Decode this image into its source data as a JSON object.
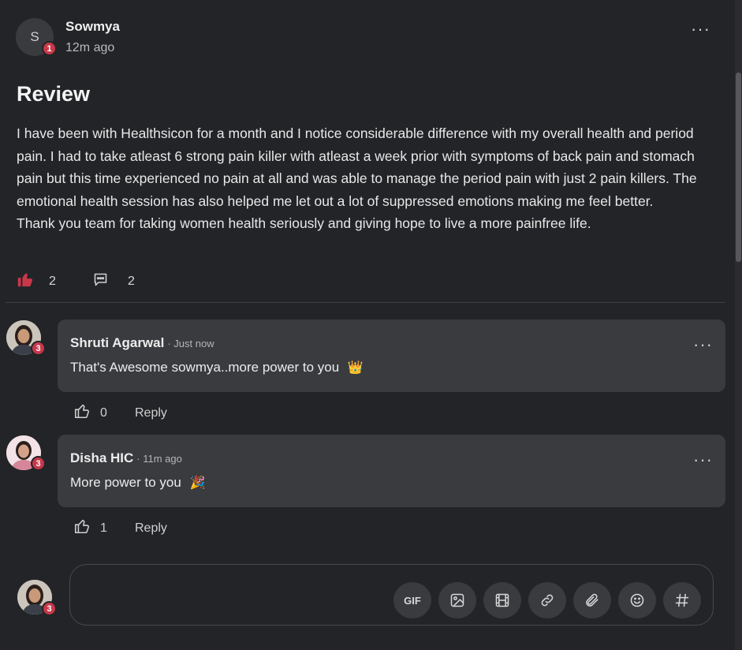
{
  "post": {
    "author_initial": "S",
    "author": "Sowmya",
    "author_badge": "1",
    "time": "12m ago",
    "title": "Review",
    "paragraph1": "I have been with Healthsicon for a month and I notice considerable difference with my overall health and period pain. I had to take atleast 6 strong pain killer with atleast a week prior with symptoms of back pain and stomach pain but this time experienced no pain at all and was able to manage the period pain with just 2 pain killers. The emotional health session has also helped me let out a lot of suppressed emotions making me feel better.",
    "paragraph2": "Thank you team for taking women health seriously and giving hope to live a more painfree life.",
    "likes": "2",
    "comments": "2"
  },
  "comments": [
    {
      "author": "Shruti Agarwal",
      "time": "· Just now",
      "text": "That's Awesome sowmya..more power to you",
      "emoji": "👑",
      "badge": "3",
      "likes": "0",
      "reply_label": "Reply"
    },
    {
      "author": "Disha HIC",
      "time": "· 11m ago",
      "text": "More power to you",
      "emoji": "🎉",
      "badge": "3",
      "likes": "1",
      "reply_label": "Reply"
    }
  ],
  "composer": {
    "badge": "3",
    "gif_label": "GIF",
    "tools": [
      "gif-icon",
      "image-icon",
      "video-icon",
      "link-icon",
      "attachment-icon",
      "emoji-icon",
      "hashtag-icon"
    ]
  },
  "colors": {
    "background": "#232427",
    "card": "#3a3b3f",
    "badge": "#c8384a",
    "like_active": "#c8384a"
  }
}
